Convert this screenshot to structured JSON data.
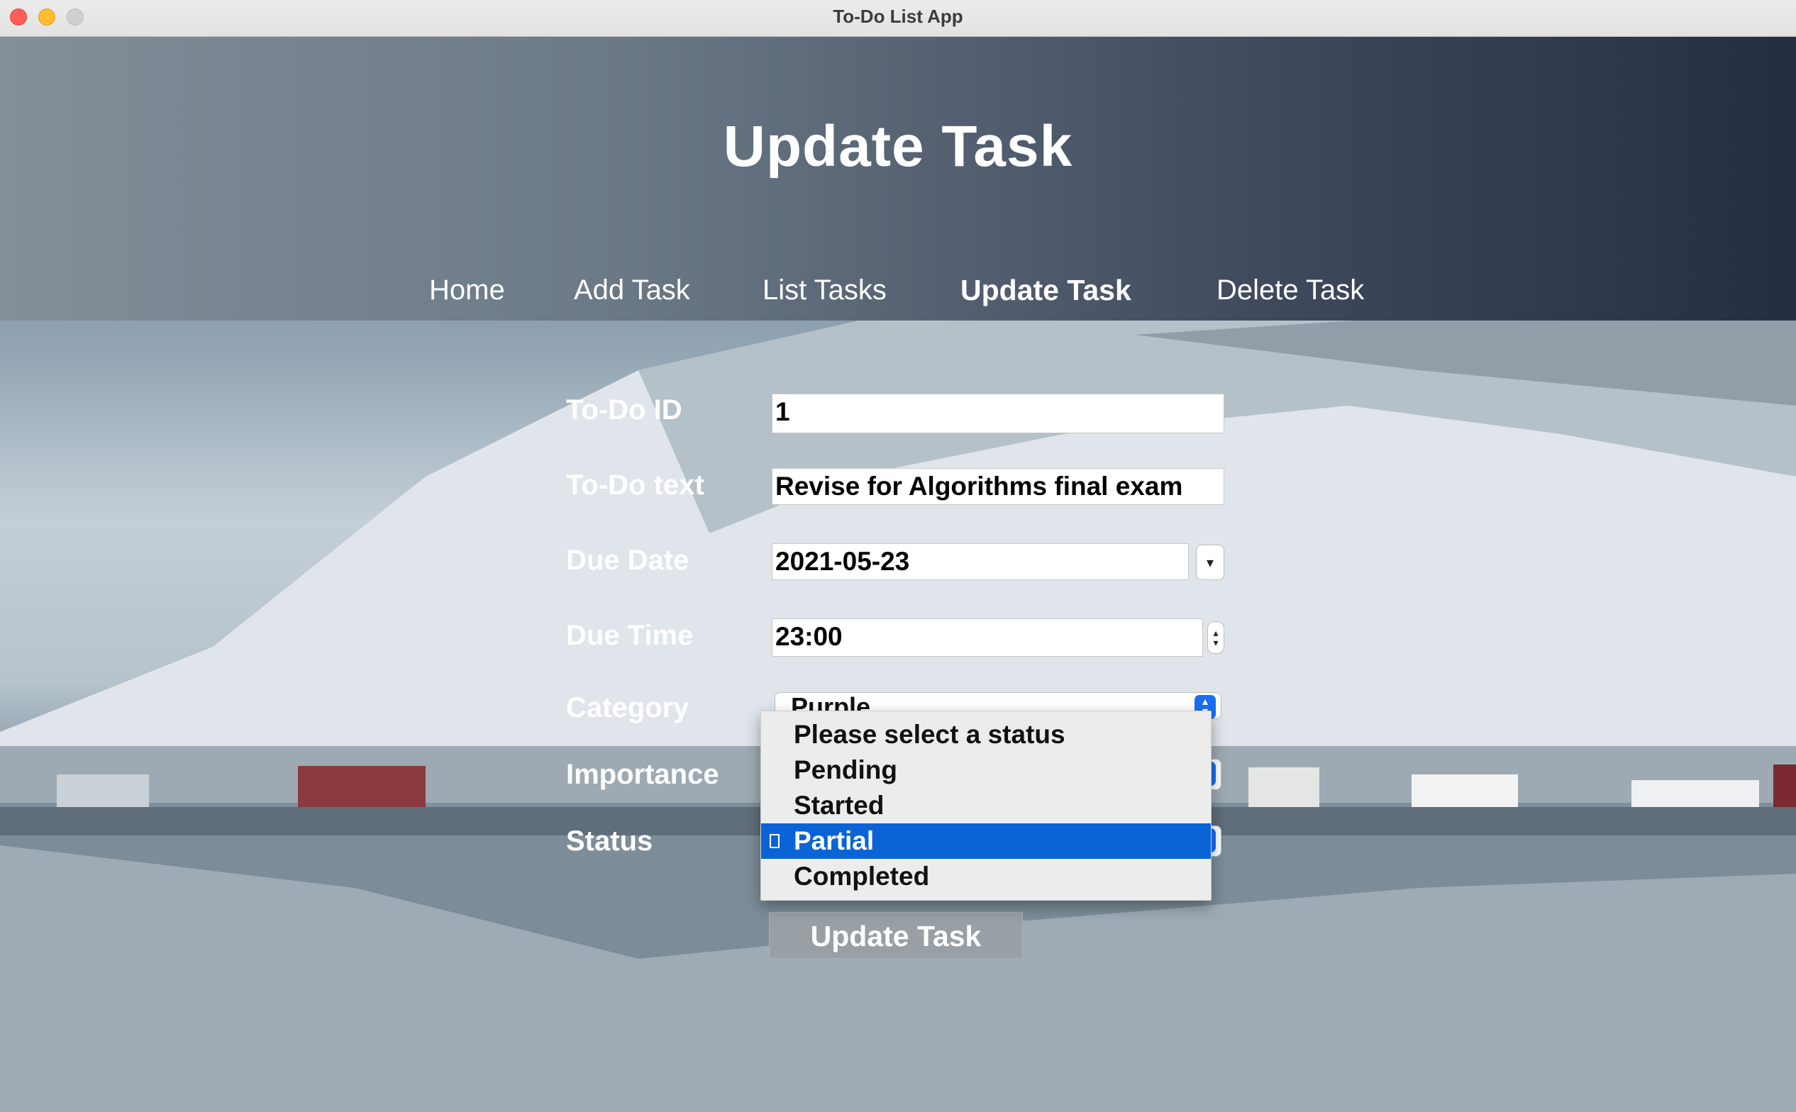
{
  "window": {
    "title": "To-Do List App"
  },
  "header": {
    "title": "Update Task"
  },
  "nav": {
    "items": [
      "Home",
      "Add Task",
      "List Tasks",
      "Update Task",
      "Delete Task"
    ],
    "active": "Update Task"
  },
  "form": {
    "todo_id": {
      "label": "To-Do ID",
      "value": "1"
    },
    "todo_text": {
      "label": "To-Do text",
      "value": "Revise for Algorithms final exam"
    },
    "due_date": {
      "label": "Due Date",
      "value": "2021-05-23"
    },
    "due_time": {
      "label": "Due Time",
      "value": "23:00"
    },
    "category": {
      "label": "Category",
      "value": "Purple"
    },
    "importance": {
      "label": "Importance"
    },
    "status": {
      "label": "Status",
      "options": [
        "Please select a status",
        "Pending",
        "Started",
        "Partial",
        "Completed"
      ],
      "selected": "Partial"
    },
    "submit_label": "Update Task"
  },
  "colors": {
    "selection": "#0a64d6",
    "accent": "#1a6ff1",
    "header_dark": "#252d43"
  }
}
